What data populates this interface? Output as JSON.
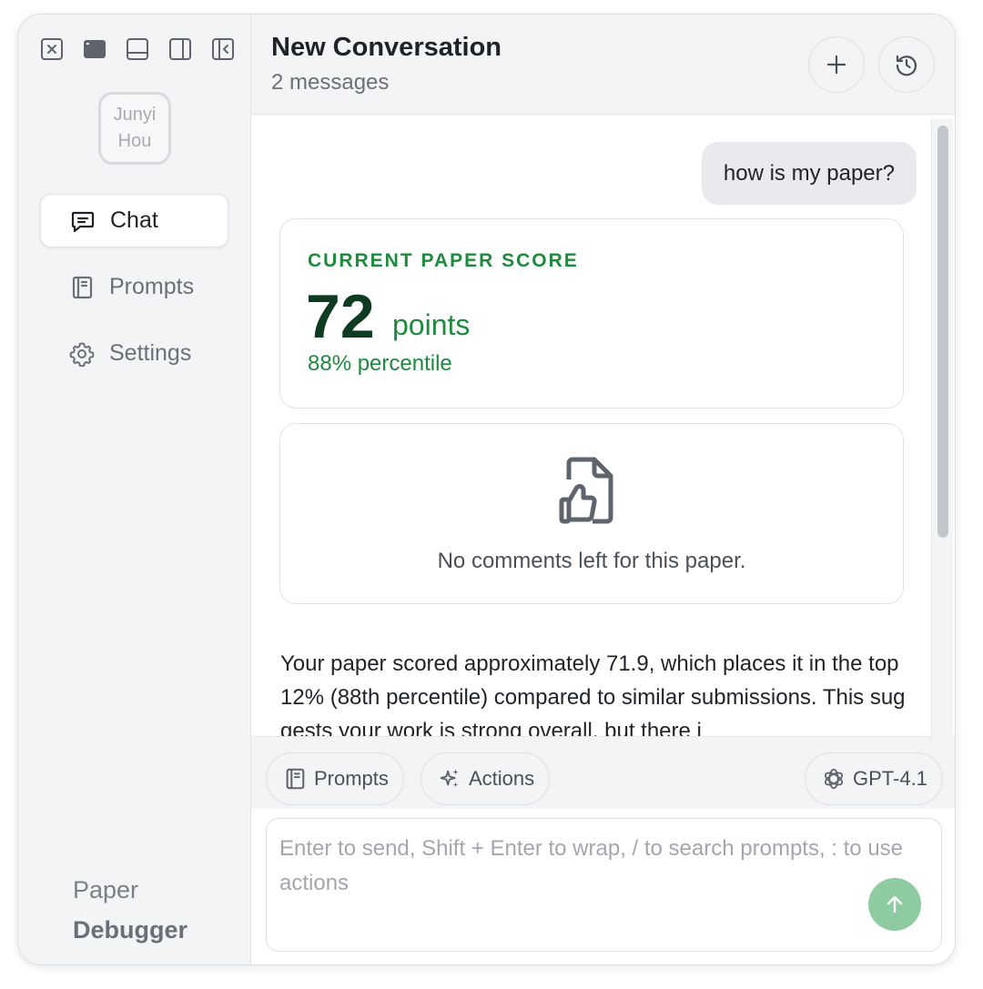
{
  "window_controls": [
    {
      "icon": "close-square-icon"
    },
    {
      "icon": "window-filled-icon"
    },
    {
      "icon": "panel-bottom-icon"
    },
    {
      "icon": "panel-right-icon"
    },
    {
      "icon": "sidebar-collapse-icon"
    }
  ],
  "sidebar": {
    "avatar_text": "Junyi Hou",
    "items": [
      {
        "label": "Chat",
        "icon": "message-square-icon",
        "active": true
      },
      {
        "label": "Prompts",
        "icon": "notebook-icon",
        "active": false
      },
      {
        "label": "Settings",
        "icon": "gear-icon",
        "active": false
      }
    ],
    "brand_line1": "Paper",
    "brand_line2": "Debugger"
  },
  "header": {
    "title": "New Conversation",
    "subtitle": "2 messages",
    "new_icon": "plus-icon",
    "history_icon": "history-icon"
  },
  "chat": {
    "user_message": "how is my paper?",
    "score": {
      "label": "CURRENT PAPER SCORE",
      "value": "72",
      "unit": "points",
      "percentile": "88% percentile",
      "accent": "#1e8a3e"
    },
    "comments": {
      "icon": "file-thumbs-up-icon",
      "text": "No comments left for this paper."
    },
    "reply": "Your paper scored approximately 71.9, which places it in the top 12% (88th percentile) compared to similar submissions. This suggests your work is strong overall, but there i"
  },
  "toolbar": {
    "prompts_label": "Prompts",
    "actions_label": "Actions",
    "model_label": "GPT-4.1"
  },
  "composer": {
    "placeholder": "Enter to send, Shift + Enter to wrap, / to search prompts, : to use actions",
    "value": "",
    "send_color": "#8fcba1"
  }
}
